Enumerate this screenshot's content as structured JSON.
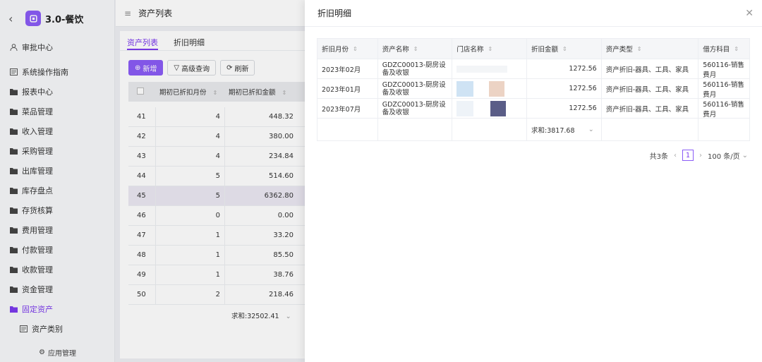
{
  "app": {
    "title": "3.0-餐饮"
  },
  "sidebar": {
    "items": [
      {
        "label": "审批中心",
        "icon": "user-icon"
      },
      {
        "label": "系统操作指南",
        "icon": "book-icon"
      },
      {
        "label": "报表中心",
        "icon": "folder-icon"
      },
      {
        "label": "菜品管理",
        "icon": "folder-icon"
      },
      {
        "label": "收入管理",
        "icon": "folder-icon"
      },
      {
        "label": "采购管理",
        "icon": "folder-icon"
      },
      {
        "label": "出库管理",
        "icon": "folder-icon"
      },
      {
        "label": "库存盘点",
        "icon": "folder-icon"
      },
      {
        "label": "存货核算",
        "icon": "folder-icon"
      },
      {
        "label": "费用管理",
        "icon": "folder-icon"
      },
      {
        "label": "付款管理",
        "icon": "folder-icon"
      },
      {
        "label": "收款管理",
        "icon": "folder-icon"
      },
      {
        "label": "资金管理",
        "icon": "folder-icon"
      },
      {
        "label": "固定资产",
        "icon": "folder-open-icon"
      },
      {
        "label": "资产类别",
        "icon": "book-icon"
      }
    ],
    "bottom": "应用管理"
  },
  "header": {
    "title": "资产列表"
  },
  "main": {
    "tabs": [
      {
        "label": "资产列表"
      },
      {
        "label": "折旧明细"
      }
    ],
    "buttons": {
      "add": "新增",
      "advanced": "高级查询",
      "refresh": "刷新"
    },
    "table": {
      "headers": [
        "期初已折扣月份",
        "期初已折扣金额"
      ],
      "rows": [
        {
          "idx": "41",
          "months": "4",
          "amount": "448.32"
        },
        {
          "idx": "42",
          "months": "4",
          "amount": "380.00"
        },
        {
          "idx": "43",
          "months": "4",
          "amount": "234.84"
        },
        {
          "idx": "44",
          "months": "5",
          "amount": "514.60"
        },
        {
          "idx": "45",
          "months": "5",
          "amount": "6362.80"
        },
        {
          "idx": "46",
          "months": "0",
          "amount": "0.00"
        },
        {
          "idx": "47",
          "months": "1",
          "amount": "33.20"
        },
        {
          "idx": "48",
          "months": "1",
          "amount": "85.50"
        },
        {
          "idx": "49",
          "months": "1",
          "amount": "38.76"
        },
        {
          "idx": "50",
          "months": "2",
          "amount": "218.46"
        }
      ],
      "sum": "求和:32502.41"
    }
  },
  "drawer": {
    "title": "折旧明细",
    "headers": [
      "折旧月份",
      "资产名称",
      "门店名称",
      "折旧金额",
      "资产类型",
      "借方科目"
    ],
    "rows": [
      {
        "month": "2023年02月",
        "name": "GDZC00013-厨房设备及收银",
        "store": "",
        "amount": "1272.56",
        "type": "资产折旧-器具、工具、家具",
        "debit": "560116-销售费月"
      },
      {
        "month": "2023年01月",
        "name": "GDZC00013-厨房设备及收银",
        "store": "",
        "amount": "1272.56",
        "type": "资产折旧-器具、工具、家具",
        "debit": "560116-销售费月"
      },
      {
        "month": "2023年07月",
        "name": "GDZC00013-厨房设备及收银",
        "store": "",
        "amount": "1272.56",
        "type": "资产折旧-器具、工具、家具",
        "debit": "560116-销售费月"
      }
    ],
    "sum": "求和:3817.68",
    "pager": {
      "total": "共3条",
      "page": "1",
      "size": "100 条/页"
    }
  }
}
